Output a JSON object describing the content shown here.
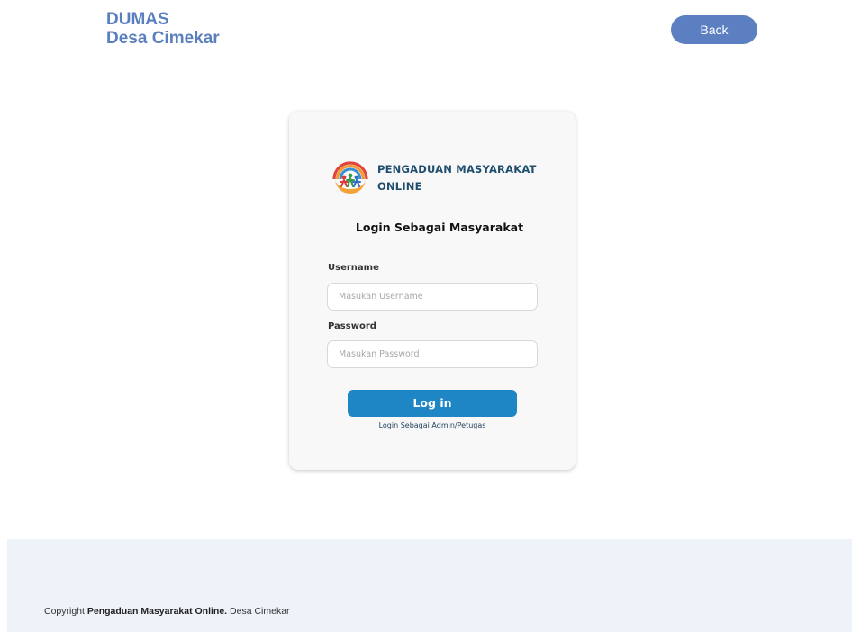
{
  "header": {
    "brand_line1": "DUMAS",
    "brand_line2": "Desa Cimekar",
    "back_label": "Back"
  },
  "card": {
    "logo_icon": "community-logo-icon",
    "logo_line1": "PENGADUAN MASYARAKAT",
    "logo_line2": "ONLINE",
    "title": "Login Sebagai Masyarakat",
    "username_label": "Username",
    "username_placeholder": "Masukan Username",
    "username_value": "",
    "password_label": "Password",
    "password_placeholder": "Masukan Password",
    "password_value": "",
    "login_label": "Log in",
    "alt_login_prefix": "Login Sebagai",
    "alt_login_link": "Admin/Petugas"
  },
  "footer": {
    "copyright_prefix": "Copyright",
    "copyright_name": "Pengaduan Masyarakat Online.",
    "copyright_suffix": "Desa Cimekar"
  },
  "colors": {
    "brand": "#5a7fbf",
    "back_button": "#5b7fc0",
    "login_button": "#1e86c4",
    "logo_text": "#1f4e6e",
    "footer_bg": "#eef2f9"
  }
}
